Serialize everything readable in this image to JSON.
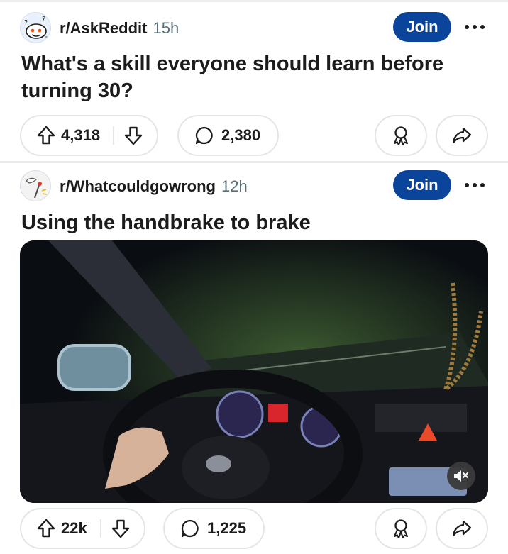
{
  "posts": [
    {
      "subreddit": "r/AskReddit",
      "age": "15h",
      "join_label": "Join",
      "title": "What's a skill everyone should learn before turning 30?",
      "upvotes": "4,318",
      "comments": "2,380"
    },
    {
      "subreddit": "r/Whatcouldgowrong",
      "age": "12h",
      "join_label": "Join",
      "title": "Using the handbrake to brake",
      "upvotes": "22k",
      "comments": "1,225"
    }
  ],
  "colors": {
    "join_button": "#0a449b",
    "pill_border": "#e3e6e8",
    "meta_gray": "#576f76"
  },
  "icons": [
    "upvote-icon",
    "downvote-icon",
    "comment-icon",
    "award-icon",
    "share-icon",
    "more-icon",
    "mute-icon"
  ]
}
